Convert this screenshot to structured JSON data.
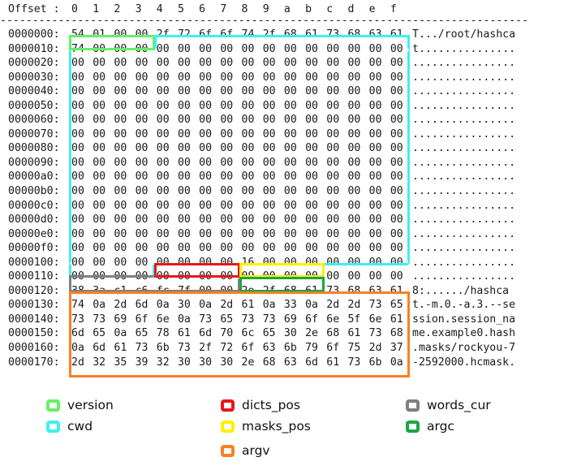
{
  "hexdump": {
    "header": {
      "offset_label": "Offset :",
      "columns": [
        "0",
        "1",
        "2",
        "3",
        "4",
        "5",
        "6",
        "7",
        "8",
        "9",
        "a",
        "b",
        "c",
        "d",
        "e",
        "f"
      ],
      "rule": "----------------------------------------------------------------------------------"
    },
    "rows": [
      {
        "offset": "0000000:",
        "bytes": [
          "54",
          "01",
          "00",
          "00",
          "2f",
          "72",
          "6f",
          "6f",
          "74",
          "2f",
          "68",
          "61",
          "73",
          "68",
          "63",
          "61"
        ],
        "ascii": "T.../root/hashca"
      },
      {
        "offset": "0000010:",
        "bytes": [
          "74",
          "00",
          "00",
          "00",
          "00",
          "00",
          "00",
          "00",
          "00",
          "00",
          "00",
          "00",
          "00",
          "00",
          "00",
          "00"
        ],
        "ascii": "t..............."
      },
      {
        "offset": "0000020:",
        "bytes": [
          "00",
          "00",
          "00",
          "00",
          "00",
          "00",
          "00",
          "00",
          "00",
          "00",
          "00",
          "00",
          "00",
          "00",
          "00",
          "00"
        ],
        "ascii": "................"
      },
      {
        "offset": "0000030:",
        "bytes": [
          "00",
          "00",
          "00",
          "00",
          "00",
          "00",
          "00",
          "00",
          "00",
          "00",
          "00",
          "00",
          "00",
          "00",
          "00",
          "00"
        ],
        "ascii": "................"
      },
      {
        "offset": "0000040:",
        "bytes": [
          "00",
          "00",
          "00",
          "00",
          "00",
          "00",
          "00",
          "00",
          "00",
          "00",
          "00",
          "00",
          "00",
          "00",
          "00",
          "00"
        ],
        "ascii": "................"
      },
      {
        "offset": "0000050:",
        "bytes": [
          "00",
          "00",
          "00",
          "00",
          "00",
          "00",
          "00",
          "00",
          "00",
          "00",
          "00",
          "00",
          "00",
          "00",
          "00",
          "00"
        ],
        "ascii": "................"
      },
      {
        "offset": "0000060:",
        "bytes": [
          "00",
          "00",
          "00",
          "00",
          "00",
          "00",
          "00",
          "00",
          "00",
          "00",
          "00",
          "00",
          "00",
          "00",
          "00",
          "00"
        ],
        "ascii": "................"
      },
      {
        "offset": "0000070:",
        "bytes": [
          "00",
          "00",
          "00",
          "00",
          "00",
          "00",
          "00",
          "00",
          "00",
          "00",
          "00",
          "00",
          "00",
          "00",
          "00",
          "00"
        ],
        "ascii": "................"
      },
      {
        "offset": "0000080:",
        "bytes": [
          "00",
          "00",
          "00",
          "00",
          "00",
          "00",
          "00",
          "00",
          "00",
          "00",
          "00",
          "00",
          "00",
          "00",
          "00",
          "00"
        ],
        "ascii": "................"
      },
      {
        "offset": "0000090:",
        "bytes": [
          "00",
          "00",
          "00",
          "00",
          "00",
          "00",
          "00",
          "00",
          "00",
          "00",
          "00",
          "00",
          "00",
          "00",
          "00",
          "00"
        ],
        "ascii": "................"
      },
      {
        "offset": "00000a0:",
        "bytes": [
          "00",
          "00",
          "00",
          "00",
          "00",
          "00",
          "00",
          "00",
          "00",
          "00",
          "00",
          "00",
          "00",
          "00",
          "00",
          "00"
        ],
        "ascii": "................"
      },
      {
        "offset": "00000b0:",
        "bytes": [
          "00",
          "00",
          "00",
          "00",
          "00",
          "00",
          "00",
          "00",
          "00",
          "00",
          "00",
          "00",
          "00",
          "00",
          "00",
          "00"
        ],
        "ascii": "................"
      },
      {
        "offset": "00000c0:",
        "bytes": [
          "00",
          "00",
          "00",
          "00",
          "00",
          "00",
          "00",
          "00",
          "00",
          "00",
          "00",
          "00",
          "00",
          "00",
          "00",
          "00"
        ],
        "ascii": "................"
      },
      {
        "offset": "00000d0:",
        "bytes": [
          "00",
          "00",
          "00",
          "00",
          "00",
          "00",
          "00",
          "00",
          "00",
          "00",
          "00",
          "00",
          "00",
          "00",
          "00",
          "00"
        ],
        "ascii": "................"
      },
      {
        "offset": "00000e0:",
        "bytes": [
          "00",
          "00",
          "00",
          "00",
          "00",
          "00",
          "00",
          "00",
          "00",
          "00",
          "00",
          "00",
          "00",
          "00",
          "00",
          "00"
        ],
        "ascii": "................"
      },
      {
        "offset": "00000f0:",
        "bytes": [
          "00",
          "00",
          "00",
          "00",
          "00",
          "00",
          "00",
          "00",
          "00",
          "00",
          "00",
          "00",
          "00",
          "00",
          "00",
          "00"
        ],
        "ascii": "................"
      },
      {
        "offset": "0000100:",
        "bytes": [
          "00",
          "00",
          "00",
          "00",
          "00",
          "00",
          "00",
          "00",
          "16",
          "00",
          "00",
          "00",
          "00",
          "00",
          "00",
          "00"
        ],
        "ascii": "................"
      },
      {
        "offset": "0000110:",
        "bytes": [
          "00",
          "00",
          "00",
          "00",
          "00",
          "00",
          "00",
          "00",
          "09",
          "00",
          "00",
          "00",
          "00",
          "00",
          "00",
          "00"
        ],
        "ascii": "................"
      },
      {
        "offset": "0000120:",
        "bytes": [
          "38",
          "3a",
          "c1",
          "c6",
          "fc",
          "7f",
          "00",
          "00",
          "2e",
          "2f",
          "68",
          "61",
          "73",
          "68",
          "63",
          "61"
        ],
        "ascii": "8:....../hashca"
      },
      {
        "offset": "0000130:",
        "bytes": [
          "74",
          "0a",
          "2d",
          "6d",
          "0a",
          "30",
          "0a",
          "2d",
          "61",
          "0a",
          "33",
          "0a",
          "2d",
          "2d",
          "73",
          "65"
        ],
        "ascii": "t.-m.0.-a.3.--se"
      },
      {
        "offset": "0000140:",
        "bytes": [
          "73",
          "73",
          "69",
          "6f",
          "6e",
          "0a",
          "73",
          "65",
          "73",
          "73",
          "69",
          "6f",
          "6e",
          "5f",
          "6e",
          "61"
        ],
        "ascii": "ssion.session_na"
      },
      {
        "offset": "0000150:",
        "bytes": [
          "6d",
          "65",
          "0a",
          "65",
          "78",
          "61",
          "6d",
          "70",
          "6c",
          "65",
          "30",
          "2e",
          "68",
          "61",
          "73",
          "68"
        ],
        "ascii": "me.example0.hash"
      },
      {
        "offset": "0000160:",
        "bytes": [
          "0a",
          "6d",
          "61",
          "73",
          "6b",
          "73",
          "2f",
          "72",
          "6f",
          "63",
          "6b",
          "79",
          "6f",
          "75",
          "2d",
          "37"
        ],
        "ascii": ".masks/rockyou-7"
      },
      {
        "offset": "0000170:",
        "bytes": [
          "2d",
          "32",
          "35",
          "39",
          "32",
          "30",
          "30",
          "30",
          "2e",
          "68",
          "63",
          "6d",
          "61",
          "73",
          "6b",
          "0a"
        ],
        "ascii": "-2592000.hcmask."
      }
    ]
  },
  "highlights": [
    {
      "name": "version",
      "color": "#66f066"
    },
    {
      "name": "cwd",
      "color": "#3ef0f0"
    },
    {
      "name": "dicts_pos",
      "color": "#e8171c"
    },
    {
      "name": "masks_pos",
      "color": "#fff000"
    },
    {
      "name": "words_cur",
      "color": "#808080"
    },
    {
      "name": "argc",
      "color": "#1aa540"
    },
    {
      "name": "argv",
      "color": "#f98023"
    }
  ],
  "legend": {
    "items": [
      {
        "label": "version",
        "color": "#66f066"
      },
      {
        "label": "cwd",
        "color": "#3ef0f0"
      },
      {
        "label": "dicts_pos",
        "color": "#e8171c"
      },
      {
        "label": "masks_pos",
        "color": "#fff000"
      },
      {
        "label": "argv",
        "color": "#f98023"
      },
      {
        "label": "words_cur",
        "color": "#808080"
      },
      {
        "label": "argc",
        "color": "#1aa540"
      }
    ]
  }
}
